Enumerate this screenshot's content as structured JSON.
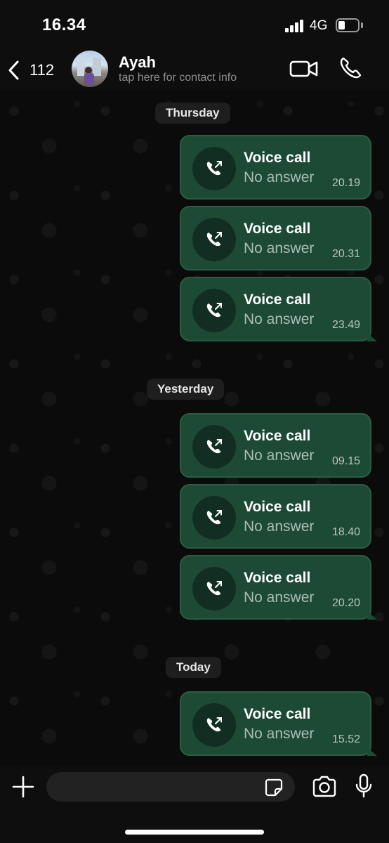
{
  "status_bar": {
    "time": "16.34",
    "network": "4G"
  },
  "header": {
    "back_count": "112",
    "contact_name": "Ayah",
    "contact_subtitle": "tap here for contact info"
  },
  "chat": {
    "sections": [
      {
        "date": "Thursday",
        "calls": [
          {
            "title": "Voice call",
            "status": "No answer",
            "time": "20.19"
          },
          {
            "title": "Voice call",
            "status": "No answer",
            "time": "20.31"
          },
          {
            "title": "Voice call",
            "status": "No answer",
            "time": "23.49"
          }
        ]
      },
      {
        "date": "Yesterday",
        "calls": [
          {
            "title": "Voice call",
            "status": "No answer",
            "time": "09.15"
          },
          {
            "title": "Voice call",
            "status": "No answer",
            "time": "18.40"
          },
          {
            "title": "Voice call",
            "status": "No answer",
            "time": "20.20"
          }
        ]
      },
      {
        "date": "Today",
        "calls": [
          {
            "title": "Voice call",
            "status": "No answer",
            "time": "15.52"
          }
        ]
      }
    ]
  },
  "input": {
    "placeholder": ""
  },
  "colors": {
    "bubble": "#1d4a35",
    "bubble_border": "#2a5d44",
    "background": "#0b0b0b"
  }
}
